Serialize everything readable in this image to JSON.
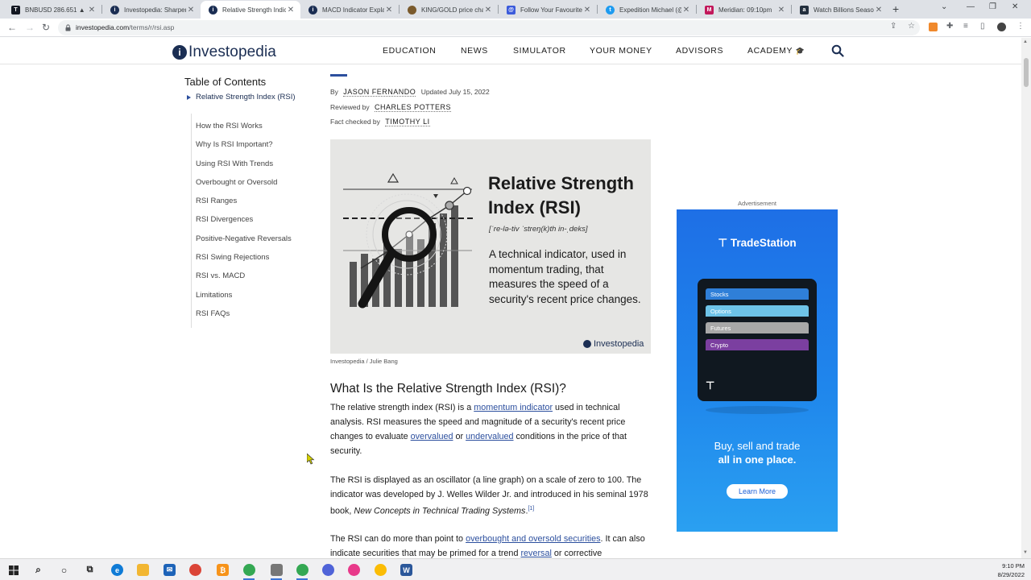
{
  "browser": {
    "tabs": [
      {
        "title": "BNBUSD 286.651 ▲ +0.",
        "favicon": "tradingview",
        "color": "#131722"
      },
      {
        "title": "Investopedia: Sharper",
        "favicon": "investopedia",
        "color": "#1b2e53"
      },
      {
        "title": "Relative Strength Indic",
        "favicon": "investopedia",
        "color": "#1b2e53",
        "active": true
      },
      {
        "title": "MACD Indicator Explai",
        "favicon": "investopedia",
        "color": "#1b2e53"
      },
      {
        "title": "KING/GOLD price char",
        "favicon": "coin",
        "color": "#7a5a2c"
      },
      {
        "title": "Follow Your Favourite",
        "favicon": "app",
        "color": "#3b5bdb"
      },
      {
        "title": "Expedition Michael (@",
        "favicon": "twitter",
        "color": "#1d9bf0"
      },
      {
        "title": "Meridian: 09:10pm",
        "favicon": "meridian",
        "color": "#c2185b"
      },
      {
        "title": "Watch Billions Season",
        "favicon": "amazon",
        "color": "#232f3e"
      }
    ],
    "url_host": "investopedia.com",
    "url_path": "/terms/r/rsi.asp"
  },
  "site": {
    "logo_text": "Investopedia",
    "nav": [
      "EDUCATION",
      "NEWS",
      "SIMULATOR",
      "YOUR MONEY",
      "ADVISORS",
      "ACADEMY"
    ]
  },
  "toc": {
    "title": "Table of Contents",
    "items": [
      "Relative Strength Index (RSI)",
      "How the RSI Works",
      "Why Is RSI Important?",
      "Using RSI With Trends",
      "Overbought or Oversold",
      "RSI Ranges",
      "RSI Divergences",
      "Positive-Negative Reversals",
      "RSI Swing Rejections",
      "RSI vs. MACD",
      "Limitations",
      "RSI FAQs"
    ]
  },
  "byline": {
    "by_label": "By",
    "author": "JASON FERNANDO",
    "updated": "Updated July 15, 2022",
    "reviewed_label": "Reviewed by",
    "reviewer": "CHARLES POTTERS",
    "factcheck_label": "Fact checked by",
    "factchecker": "TIMOTHY LI"
  },
  "hero": {
    "title_line1": "Relative Strength",
    "title_line2": "Index (RSI)",
    "phonetic": "[ˈre-lə-tiv ˈstreŋ(k)th in-ˌdeks]",
    "description": "A technical indicator, used in momentum trading, that measures the speed of a security's recent price changes.",
    "brand": "Investopedia",
    "caption": "Investopedia / Julie Bang"
  },
  "article": {
    "heading": "What Is the Relative Strength Index (RSI)?",
    "p1_a": "The relative strength index (RSI) is a ",
    "p1_link1": "momentum indicator",
    "p1_b": " used in technical analysis. RSI measures the speed and magnitude of a security's recent price changes to evaluate ",
    "p1_link2": "overvalued",
    "p1_c": " or ",
    "p1_link3": "undervalued",
    "p1_d": " conditions in the price of that security.",
    "p2_a": "The RSI is displayed as an oscillator (a line graph) on a scale of zero to 100. The indicator was developed by J. Welles Wilder Jr. and introduced in his seminal 1978 book, ",
    "p2_book": "New Concepts in Technical Trading Systems",
    "p2_b": ".",
    "p2_ref": "[1]",
    "p3_a": "The RSI can do more than point to ",
    "p3_link1": "overbought and oversold securities",
    "p3_b": ". It can also indicate securities that may be primed for a trend ",
    "p3_link2": "reversal",
    "p3_c": " or corrective"
  },
  "ad": {
    "label": "Advertisement",
    "brand": "TradeStation",
    "pills": [
      "Stocks",
      "Options",
      "Futures",
      "Crypto"
    ],
    "pill_colors": [
      "#2f7fd8",
      "#6ec3e8",
      "#a8a8a8",
      "#7b3fa0"
    ],
    "tagline1": "Buy, sell and trade",
    "tagline2": "all in one place.",
    "cta": "Learn More"
  },
  "taskbar": {
    "time": "9:10 PM",
    "date": "8/29/2022"
  }
}
